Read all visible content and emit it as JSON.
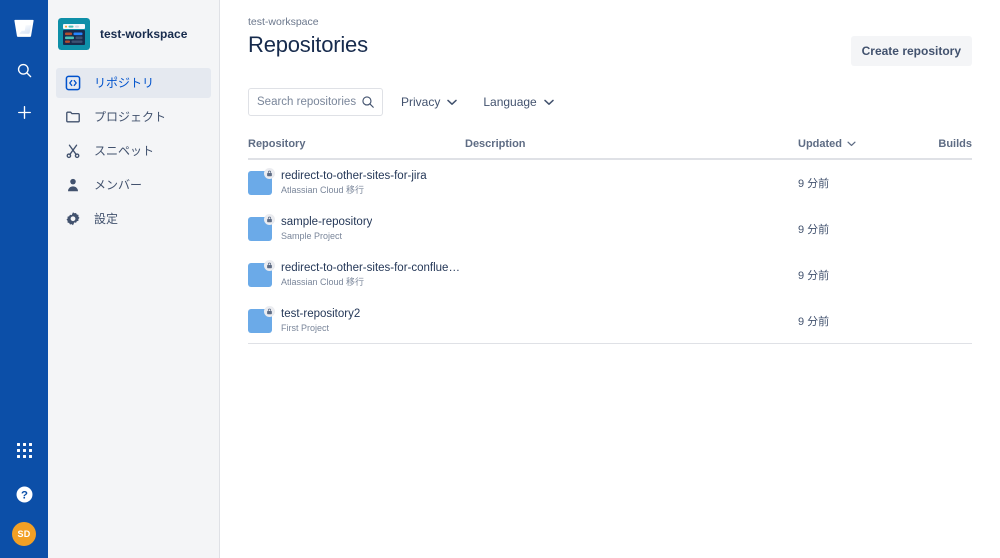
{
  "rail": {
    "logo": "bitbucket-logo",
    "top_actions": [
      {
        "name": "search-icon",
        "label": "Search"
      },
      {
        "name": "create-icon",
        "label": "Create"
      }
    ],
    "bottom_actions": [
      {
        "name": "app-switcher-icon",
        "label": "Switch to..."
      },
      {
        "name": "help-icon",
        "label": "Help"
      }
    ],
    "avatar_initials": "SD",
    "colors": {
      "background": "#0C4FA8",
      "avatar": "#F2A025"
    }
  },
  "sidebar": {
    "workspace_name": "test-workspace",
    "items": [
      {
        "label": "リポジトリ",
        "icon": "repository-icon",
        "selected": true
      },
      {
        "label": "プロジェクト",
        "icon": "folder-icon",
        "selected": false
      },
      {
        "label": "スニペット",
        "icon": "scissors-icon",
        "selected": false
      },
      {
        "label": "メンバー",
        "icon": "person-icon",
        "selected": false
      },
      {
        "label": "設定",
        "icon": "gear-icon",
        "selected": false
      }
    ],
    "colors": {
      "background": "#F4F5F7",
      "selected": "#E5E9F0",
      "accent": "#0052CC"
    }
  },
  "header": {
    "breadcrumb": "test-workspace",
    "title": "Repositories",
    "create_button": "Create repository"
  },
  "filters": {
    "search_placeholder": "Search repositories",
    "search_value": "",
    "privacy_label": "Privacy",
    "language_label": "Language"
  },
  "table": {
    "columns": {
      "repository": "Repository",
      "description": "Description",
      "updated": "Updated",
      "builds": "Builds"
    },
    "sort": {
      "column": "Updated",
      "direction": "desc"
    },
    "rows": [
      {
        "name": "redirect-to-other-sites-for-jira",
        "project": "Atlassian Cloud 移行",
        "description": "",
        "updated": "9 分前",
        "builds": "",
        "private": true
      },
      {
        "name": "sample-repository",
        "project": "Sample Project",
        "description": "",
        "updated": "9 分前",
        "builds": "",
        "private": true
      },
      {
        "name": "redirect-to-other-sites-for-conflue…",
        "project": "Atlassian Cloud 移行",
        "description": "",
        "updated": "9 分前",
        "builds": "",
        "private": true
      },
      {
        "name": "test-repository2",
        "project": "First Project",
        "description": "",
        "updated": "9 分前",
        "builds": "",
        "private": true
      }
    ],
    "repo_icon_glyph": "</>",
    "repo_icon_color": "#6BAAE8"
  }
}
